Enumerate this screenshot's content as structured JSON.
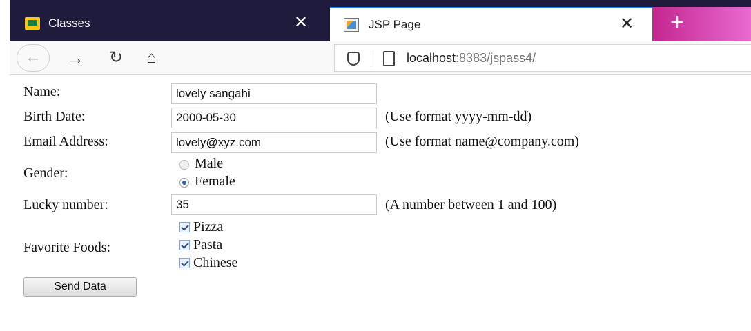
{
  "browser": {
    "tabs": [
      {
        "title": "Classes",
        "icon": "classroom-icon",
        "active": false
      },
      {
        "title": "JSP Page",
        "icon": "page-favicon",
        "active": true
      }
    ],
    "new_tab_label": "+",
    "close_glyph": "✕",
    "url_host": "localhost",
    "url_rest": ":8383/jspass4/"
  },
  "form": {
    "name_label": "Name:",
    "name_value": "lovely sangahi",
    "birth_label": "Birth Date:",
    "birth_value": "2000-05-30",
    "birth_hint": "(Use format yyyy-mm-dd)",
    "email_label": "Email Address:",
    "email_value": "lovely@xyz.com",
    "email_hint": "(Use format name@company.com)",
    "gender_label": "Gender:",
    "gender_options": [
      "Male",
      "Female"
    ],
    "gender_selected": "Female",
    "lucky_label": "Lucky number:",
    "lucky_value": "35",
    "lucky_hint": "(A number between 1 and 100)",
    "foods_label": "Favorite Foods:",
    "foods": [
      {
        "label": "Pizza",
        "checked": true
      },
      {
        "label": "Pasta",
        "checked": true
      },
      {
        "label": "Chinese",
        "checked": true
      }
    ],
    "submit_label": "Send Data"
  },
  "colors": {
    "tab_strip": "#1f1b3d",
    "new_tab_accent": "#c4268f",
    "active_tab_accent": "#0a84ff"
  }
}
